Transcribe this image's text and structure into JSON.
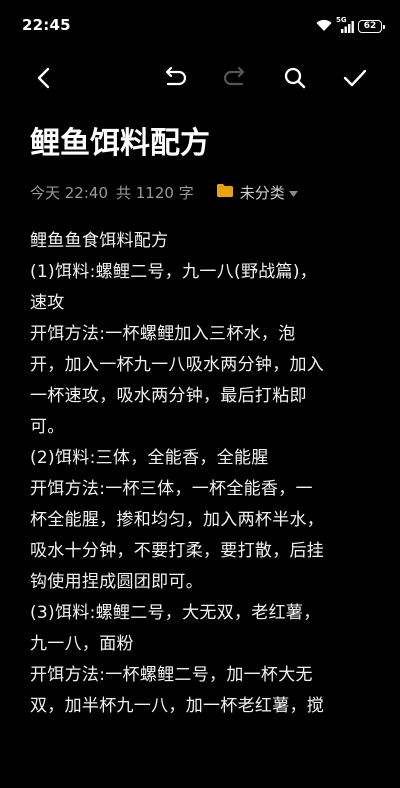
{
  "status_bar": {
    "time": "22:45",
    "network_label": "5G",
    "battery_level": "62",
    "icons": [
      "wifi-icon",
      "cellular-signal-icon",
      "battery-icon"
    ]
  },
  "toolbar": {
    "icons": [
      "back-arrow-icon",
      "undo-icon",
      "redo-icon",
      "search-icon",
      "check-icon"
    ],
    "redo_enabled": false
  },
  "note": {
    "title": "鲤鱼饵料配方",
    "date": "今天 22:40",
    "word_count": "共 1120 字",
    "folder": "未分类",
    "folder_color": "#E5A50A",
    "lines": [
      "鲤鱼鱼食饵料配方",
      "(1)饵料:螺鲤二号，九一八(野战篇)，",
      "速攻",
      "开饵方法:一杯螺鲤加入三杯水，泡",
      "开，加入一杯九一八吸水两分钟，加入",
      "一杯速攻，吸水两分钟，最后打粘即",
      "可。",
      "(2)饵料:三体，全能香，全能腥",
      "开饵方法:一杯三体，一杯全能香，一",
      "杯全能腥，掺和均匀，加入两杯半水，",
      "吸水十分钟，不要打柔，要打散，后挂",
      "钩使用捏成圆团即可。",
      "(3)饵料:螺鲤二号，大无双，老红薯，",
      "九一八，面粉",
      "开饵方法:一杯螺鲤二号，加一杯大无",
      "双，加半杯九一八，加一杯老红薯，搅"
    ]
  }
}
